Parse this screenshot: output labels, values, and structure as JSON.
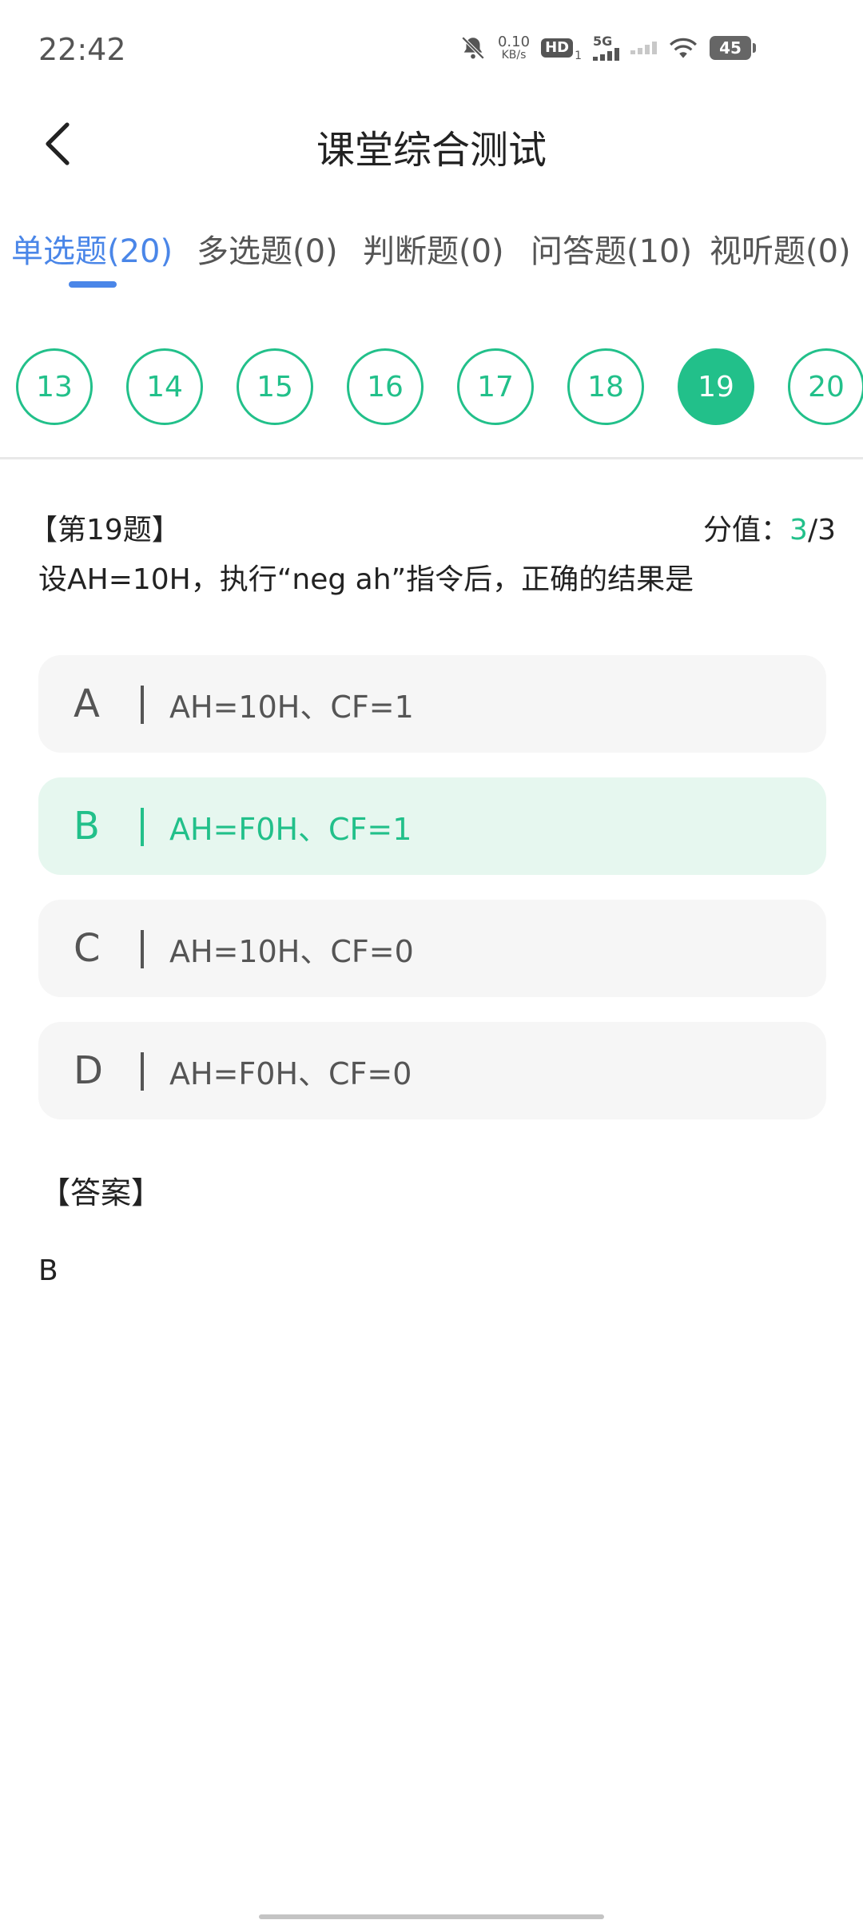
{
  "status_bar": {
    "time": "22:42",
    "net_speed_value": "0.10",
    "net_speed_unit": "KB/s",
    "hd_label": "HD",
    "hd_sub": "1",
    "network_type": "5G",
    "battery": "45",
    "icons": [
      "bell-muted-icon",
      "hd-icon",
      "signal-5g-icon",
      "signal-icon",
      "wifi-icon",
      "battery-icon"
    ]
  },
  "header": {
    "title": "课堂综合测试"
  },
  "tabs": [
    {
      "label": "单选题(20)",
      "active": true
    },
    {
      "label": "多选题(0)",
      "active": false
    },
    {
      "label": "判断题(0)",
      "active": false
    },
    {
      "label": "问答题(10)",
      "active": false
    },
    {
      "label": "视听题(0)",
      "active": false
    }
  ],
  "question_numbers": [
    {
      "n": "13",
      "active": false
    },
    {
      "n": "14",
      "active": false
    },
    {
      "n": "15",
      "active": false
    },
    {
      "n": "16",
      "active": false
    },
    {
      "n": "17",
      "active": false
    },
    {
      "n": "18",
      "active": false
    },
    {
      "n": "19",
      "active": true
    },
    {
      "n": "20",
      "active": false
    }
  ],
  "question": {
    "label": "【第19题】",
    "score_prefix": "分值：",
    "score_got": "3",
    "score_total": "/3",
    "text": "设AH=10H，执行“neg ah”指令后，正确的结果是"
  },
  "options": [
    {
      "letter": "A",
      "text": "AH=10H、CF=1",
      "selected": false
    },
    {
      "letter": "B",
      "text": "AH=F0H、CF=1",
      "selected": true
    },
    {
      "letter": "C",
      "text": "AH=10H、CF=0",
      "selected": false
    },
    {
      "letter": "D",
      "text": "AH=F0H、CF=0",
      "selected": false
    }
  ],
  "answer": {
    "label": "【答案】",
    "value": "B"
  },
  "colors": {
    "accent_green": "#22c08a",
    "accent_blue": "#4a86e8",
    "selected_bg": "#e6f7ef",
    "option_bg": "#f6f6f6"
  }
}
